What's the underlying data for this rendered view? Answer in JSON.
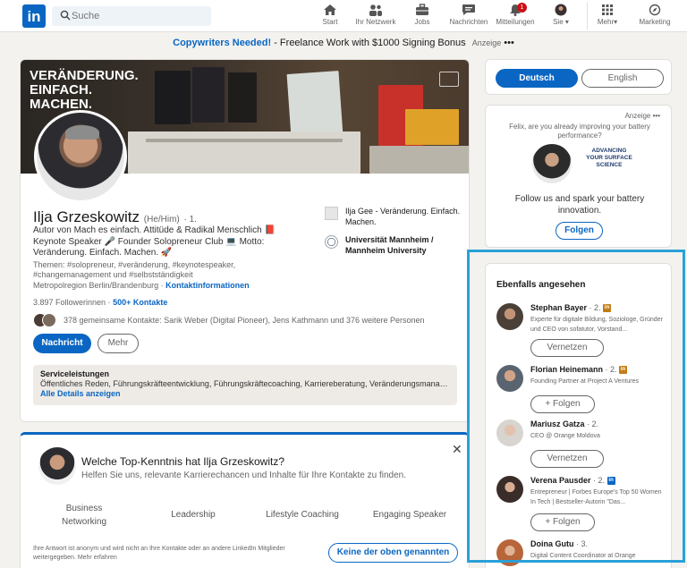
{
  "nav": {
    "logo": "in",
    "search_placeholder": "Suche",
    "items": [
      {
        "label": "Start",
        "icon": "home-icon"
      },
      {
        "label": "Ihr Netzwerk",
        "icon": "network-icon"
      },
      {
        "label": "Jobs",
        "icon": "briefcase-icon"
      },
      {
        "label": "Nachrichten",
        "icon": "messaging-icon"
      },
      {
        "label": "Mitteilungen",
        "icon": "bell-icon",
        "badge": "1"
      },
      {
        "label": "Sie",
        "icon": "me-avatar-icon"
      },
      {
        "label": "Mehr",
        "icon": "grid-icon"
      },
      {
        "label": "Marketing",
        "icon": "compass-icon"
      }
    ]
  },
  "promo": {
    "title": "Copywriters Needed!",
    "text": " - Freelance Work with $1000 Signing Bonus",
    "ad_label": "Anzeige",
    "more": "•••"
  },
  "profile": {
    "banner_text": "VERÄNDERUNG. EINFACH. MACHEN.",
    "name": "Ilja Grzeskowitz",
    "pronouns": "(He/Him)",
    "degree": "· 1.",
    "headline": "Autor von Mach es einfach. Attitüde & Radikal Menschlich 📕 Keynote Speaker 🎤 Founder Solopreneur Club 💻 Motto: Veränderung. Einfach. Machen. 🚀",
    "themes": "Themen: #solopreneur, #veränderung, #keynotespeaker, #changemanagement und #selbstständigkeit",
    "location": "Metropolregion Berlin/Brandenburg ·",
    "contact_info": "Kontaktinformationen",
    "followers": "3.897 Followerinnen ·",
    "connections": "500+ Kontakte",
    "mutual": "378 gemeinsame Kontakte: Sarik Weber (Digital Pioneer), Jens Kathmann und 376 weitere Personen",
    "message_button": "Nachricht",
    "more_button": "Mehr",
    "experience": [
      {
        "text": "Ilja Gee - Veränderung. Einfach. Machen."
      },
      {
        "text": "Universität Mannheim / Mannheim University"
      }
    ],
    "services": {
      "heading": "Serviceleistungen",
      "detail": "Öffentliches Reden, Führungskräfteentwicklung, Führungskräftecoaching, Karriereberatung, Veränderungsmanage...",
      "link": "Alle Details anzeigen"
    }
  },
  "skill_card": {
    "question": "Welche Top-Kenntnis hat Ilja Grzeskowitz?",
    "subtitle": "Helfen Sie uns, relevante Karrierechancen und Inhalte für Ihre Kontakte zu finden.",
    "close": "✕",
    "options": [
      "Business Networking",
      "Leadership",
      "Lifestyle Coaching",
      "Engaging Speaker"
    ],
    "note": "Ihre Antwort ist anonym und wird nicht an Ihre Kontakte oder an andere LinkedIn Mitglieder weitergegeben. Mehr erfahren",
    "none_button": "Keine der oben genannten"
  },
  "language": {
    "selected": "Deutsch",
    "other": "English"
  },
  "ad": {
    "label": "Anzeige",
    "more": "•••",
    "line": "Felix, are you already improving your battery performance?",
    "brand": "ADVANCING YOUR SURFACE SCIENCE",
    "message": "Follow us and spark your battery innovation.",
    "follow_button": "Folgen"
  },
  "also_viewed": {
    "title": "Ebenfalls angesehen",
    "people": [
      {
        "name": "Stephan Bayer",
        "degree": "· 2.",
        "desc": "Experte für digitale Bildung, Soziologe, Gründer und CEO von sofatutor, Vorstand...",
        "button": "Vernetzen",
        "avatar": "#4a4038"
      },
      {
        "name": "Florian Heinemann",
        "degree": "· 2.",
        "desc": "Founding Partner at Project A Ventures",
        "button": "+ Folgen",
        "avatar": "#5a6470"
      },
      {
        "name": "Mariusz Gatza",
        "degree": "· 2.",
        "desc": "CEO @ Orange Moldova",
        "button": "Vernetzen",
        "avatar": "#d8d4cf"
      },
      {
        "name": "Verena Pausder",
        "degree": "· 2.",
        "desc": "Entrepreneur | Forbes Europe's Top 50 Women In Tech | Bestseller-Autorin \"Das...",
        "button": "+ Folgen",
        "avatar": "#3a2c28"
      },
      {
        "name": "Doina Gutu",
        "degree": "· 3.",
        "desc": "Digital Content Coordinator at Orange",
        "button": "",
        "avatar": "#b8653a"
      }
    ]
  },
  "colors": {
    "brand": "#0a66c2",
    "highlight": "#2aa0d8",
    "badge": "#cc1016"
  }
}
